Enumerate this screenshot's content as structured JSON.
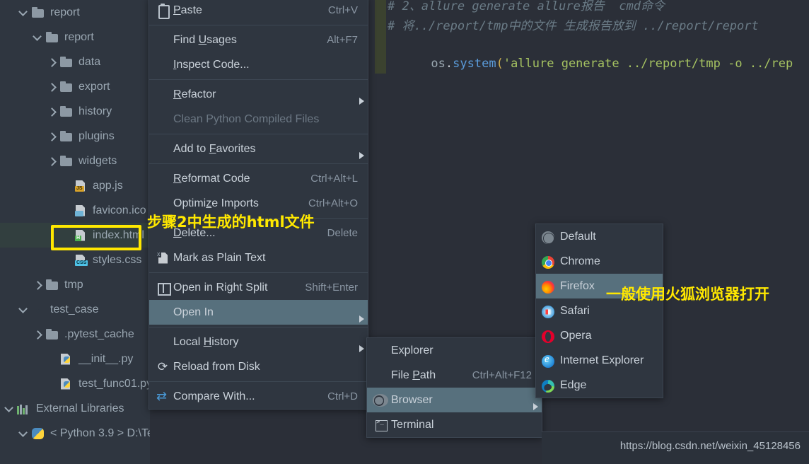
{
  "editor": {
    "lines": [
      {
        "type": "comment",
        "text": "# 2、allure generate allure报告  cmd命令"
      },
      {
        "type": "comment",
        "text": "# 将../report/tmp中的文件 生成报告放到 ../report/report"
      },
      {
        "type": "code",
        "parts": [
          {
            "cls": "tok-obj",
            "text": "os"
          },
          {
            "cls": "tok-dot",
            "text": "."
          },
          {
            "cls": "tok-fn",
            "text": "system"
          },
          {
            "cls": "tok-par",
            "text": "("
          },
          {
            "cls": "tok-str",
            "text": "'allure generate ../report/tmp -o ../rep"
          }
        ]
      }
    ]
  },
  "sidebar": {
    "items": [
      {
        "label": "report",
        "indent": 0,
        "chev": "down",
        "icon": "folder",
        "badge": ""
      },
      {
        "label": "report",
        "indent": 1,
        "chev": "down",
        "icon": "folder",
        "badge": ""
      },
      {
        "label": "data",
        "indent": 2,
        "chev": "right",
        "icon": "folder",
        "badge": ""
      },
      {
        "label": "export",
        "indent": 2,
        "chev": "right",
        "icon": "folder",
        "badge": ""
      },
      {
        "label": "history",
        "indent": 2,
        "chev": "right",
        "icon": "folder",
        "badge": ""
      },
      {
        "label": "plugins",
        "indent": 2,
        "chev": "right",
        "icon": "folder",
        "badge": ""
      },
      {
        "label": "widgets",
        "indent": 2,
        "chev": "right",
        "icon": "folder",
        "badge": ""
      },
      {
        "label": "app.js",
        "indent": 3,
        "chev": "none",
        "icon": "file",
        "badge": "js"
      },
      {
        "label": "favicon.ico",
        "indent": 3,
        "chev": "none",
        "icon": "file",
        "badge": "img"
      },
      {
        "label": "index.html",
        "indent": 3,
        "chev": "none",
        "icon": "file",
        "badge": "html",
        "selected": true
      },
      {
        "label": "styles.css",
        "indent": 3,
        "chev": "none",
        "icon": "file",
        "badge": "css"
      },
      {
        "label": "tmp",
        "indent": 1,
        "chev": "right",
        "icon": "folder",
        "badge": ""
      },
      {
        "label": "test_case",
        "indent": 0,
        "chev": "down",
        "icon": "folder-src",
        "badge": ""
      },
      {
        "label": ".pytest_cache",
        "indent": 1,
        "chev": "right",
        "icon": "folder",
        "badge": ""
      },
      {
        "label": "__init__.py",
        "indent": 2,
        "chev": "none",
        "icon": "py",
        "badge": ""
      },
      {
        "label": "test_func01.py",
        "indent": 2,
        "chev": "none",
        "icon": "py",
        "badge": ""
      },
      {
        "label": "External Libraries",
        "indent": -1,
        "chev": "down",
        "icon": "libs",
        "badge": ""
      },
      {
        "label": "< Python 3.9 >  D:\\Te",
        "indent": 0,
        "chev": "down",
        "icon": "pybig",
        "badge": ""
      }
    ]
  },
  "context_menu": {
    "items": [
      {
        "label": "Paste",
        "underline": "P",
        "shortcut": "Ctrl+V",
        "icon": "clipboard-icon",
        "arrow": false,
        "disabled": false
      },
      {
        "sep": true
      },
      {
        "label": "Find Usages",
        "underline": "U",
        "shortcut": "Alt+F7",
        "icon": "",
        "arrow": false,
        "disabled": false
      },
      {
        "label": "Inspect Code...",
        "underline": "I",
        "shortcut": "",
        "icon": "",
        "arrow": false,
        "disabled": false
      },
      {
        "sep": true
      },
      {
        "label": "Refactor",
        "underline": "R",
        "shortcut": "",
        "icon": "",
        "arrow": true,
        "disabled": false
      },
      {
        "label": "Clean Python Compiled Files",
        "underline": "",
        "shortcut": "",
        "icon": "",
        "arrow": false,
        "disabled": true
      },
      {
        "sep": true
      },
      {
        "label": "Add to Favorites",
        "underline": "F",
        "shortcut": "",
        "icon": "",
        "arrow": true,
        "disabled": false
      },
      {
        "sep": true
      },
      {
        "label": "Reformat Code",
        "underline": "R",
        "shortcut": "Ctrl+Alt+L",
        "icon": "",
        "arrow": false,
        "disabled": false
      },
      {
        "label": "Optimize Imports",
        "underline": "z",
        "shortcut": "Ctrl+Alt+O",
        "icon": "",
        "arrow": false,
        "disabled": false
      },
      {
        "sep": true
      },
      {
        "label": "Delete...",
        "underline": "D",
        "shortcut": "Delete",
        "icon": "",
        "arrow": false,
        "disabled": false
      },
      {
        "label": "Mark as Plain Text",
        "underline": "",
        "shortcut": "",
        "icon": "plaintext-icon",
        "arrow": false,
        "disabled": false
      },
      {
        "sep": true
      },
      {
        "label": "Open in Right Split",
        "underline": "",
        "shortcut": "Shift+Enter",
        "icon": "split-icon",
        "arrow": false,
        "disabled": false
      },
      {
        "label": "Open In",
        "underline": "",
        "shortcut": "",
        "icon": "",
        "arrow": true,
        "disabled": false,
        "selected": true
      },
      {
        "sep": true
      },
      {
        "label": "Local History",
        "underline": "H",
        "shortcut": "",
        "icon": "",
        "arrow": true,
        "disabled": false
      },
      {
        "label": "Reload from Disk",
        "underline": "",
        "shortcut": "",
        "icon": "reload-icon",
        "arrow": false,
        "disabled": false
      },
      {
        "sep": true
      },
      {
        "label": "Compare With...",
        "underline": "",
        "shortcut": "Ctrl+D",
        "icon": "compare-icon",
        "arrow": false,
        "disabled": false
      }
    ]
  },
  "open_in_submenu": {
    "items": [
      {
        "label": "Explorer",
        "underline": "",
        "shortcut": "",
        "icon": "",
        "arrow": false
      },
      {
        "label": "File Path",
        "underline": "P",
        "shortcut": "Ctrl+Alt+F12",
        "icon": "",
        "arrow": false
      },
      {
        "label": "Browser",
        "underline": "",
        "shortcut": "",
        "icon": "globe-icon",
        "arrow": true,
        "selected": true
      },
      {
        "label": "Terminal",
        "underline": "",
        "shortcut": "",
        "icon": "terminal-icon",
        "arrow": false
      }
    ]
  },
  "browser_submenu": {
    "items": [
      {
        "label": "Default",
        "icon": "default"
      },
      {
        "label": "Chrome",
        "icon": "chrome"
      },
      {
        "label": "Firefox",
        "icon": "firefox",
        "selected": true
      },
      {
        "label": "Safari",
        "icon": "safari"
      },
      {
        "label": "Opera",
        "icon": "opera"
      },
      {
        "label": "Internet Explorer",
        "icon": "ie"
      },
      {
        "label": "Edge",
        "icon": "edge"
      }
    ]
  },
  "annotations": {
    "step2": "步骤2中生成的html文件",
    "firefox": "一般使用火狐浏览器打开"
  },
  "watermark": "https://blog.csdn.net/weixin_45128456",
  "colors": {
    "menu_bg": "#2f3640",
    "menu_selected": "#57707d",
    "annotation": "#ffe800",
    "tree_selected": "#323f3f",
    "editor_bg": "#2b2f38"
  }
}
